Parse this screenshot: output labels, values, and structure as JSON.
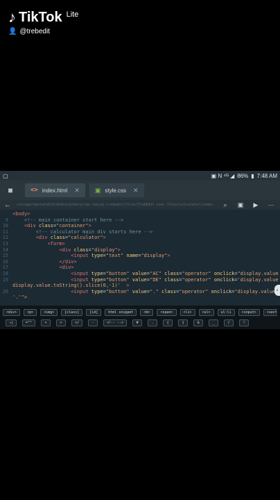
{
  "watermark": {
    "brand": "TikTok",
    "edition": "Lite",
    "username": "@trebedit"
  },
  "status_bar": {
    "indicators": "▣ N ⁴ᴳ ◢",
    "battery": "86%",
    "time": "7:48 AM"
  },
  "tabs": [
    {
      "icon": "<>",
      "label": "index.html",
      "close": "✕"
    },
    {
      "icon": "▣",
      "label": "style.css",
      "close": "✕"
    }
  ],
  "toolbar": {
    "path": "storage/emulated/0/Android/data/com.teejay.trebedit/files/TrebEdit user files/calculator/index.html"
  },
  "editor": {
    "lines": [
      {
        "n": "",
        "segs": [
          {
            "t": "<body>",
            "c": "tag"
          }
        ]
      },
      {
        "n": "9",
        "segs": [
          {
            "t": "    ",
            "c": "plain"
          },
          {
            "t": "<!-- main container start here -->",
            "c": "cmt"
          }
        ]
      },
      {
        "n": "10",
        "segs": [
          {
            "t": "    <div ",
            "c": "tag"
          },
          {
            "t": "class",
            "c": "attr"
          },
          {
            "t": "=",
            "c": "plain"
          },
          {
            "t": "\"container\"",
            "c": "str"
          },
          {
            "t": ">",
            "c": "tag"
          }
        ]
      },
      {
        "n": "11",
        "segs": [
          {
            "t": "        ",
            "c": "plain"
          },
          {
            "t": "<!-- calculator main div starts here -->",
            "c": "cmt"
          }
        ]
      },
      {
        "n": "12",
        "segs": [
          {
            "t": "        <div ",
            "c": "tag"
          },
          {
            "t": "class",
            "c": "attr"
          },
          {
            "t": "=",
            "c": "plain"
          },
          {
            "t": "\"calculator\"",
            "c": "str"
          },
          {
            "t": ">",
            "c": "tag"
          }
        ]
      },
      {
        "n": "13",
        "segs": [
          {
            "t": "            <form>",
            "c": "tag"
          }
        ]
      },
      {
        "n": "14",
        "segs": [
          {
            "t": "                <div ",
            "c": "tag"
          },
          {
            "t": "class",
            "c": "attr"
          },
          {
            "t": "=",
            "c": "plain"
          },
          {
            "t": "\"display\"",
            "c": "str"
          },
          {
            "t": ">",
            "c": "tag"
          }
        ]
      },
      {
        "n": "15",
        "segs": [
          {
            "t": "                    <input ",
            "c": "tag"
          },
          {
            "t": "type",
            "c": "attr"
          },
          {
            "t": "=",
            "c": "plain"
          },
          {
            "t": "\"text\"",
            "c": "str"
          },
          {
            "t": " name",
            "c": "attr"
          },
          {
            "t": "=",
            "c": "plain"
          },
          {
            "t": "\"display\"",
            "c": "str"
          },
          {
            "t": ">",
            "c": "tag"
          }
        ]
      },
      {
        "n": "16",
        "segs": [
          {
            "t": "                </div>",
            "c": "tag"
          }
        ]
      },
      {
        "n": "17",
        "segs": [
          {
            "t": "                <div>",
            "c": "tag"
          }
        ]
      },
      {
        "n": "18",
        "segs": [
          {
            "t": "                    <input ",
            "c": "tag"
          },
          {
            "t": "type",
            "c": "attr"
          },
          {
            "t": "=",
            "c": "plain"
          },
          {
            "t": "\"button\"",
            "c": "str"
          },
          {
            "t": " value",
            "c": "attr"
          },
          {
            "t": "=",
            "c": "plain"
          },
          {
            "t": "\"AC\"",
            "c": "str"
          },
          {
            "t": " class",
            "c": "attr"
          },
          {
            "t": "=",
            "c": "plain"
          },
          {
            "t": "\"operator\"",
            "c": "str"
          },
          {
            "t": " onclick",
            "c": "attr"
          },
          {
            "t": "=",
            "c": "plain"
          },
          {
            "t": "\"display.value = ''\">",
            "c": "str"
          }
        ]
      },
      {
        "n": "19",
        "segs": [
          {
            "t": "                    <input ",
            "c": "tag"
          },
          {
            "t": "type",
            "c": "attr"
          },
          {
            "t": "=",
            "c": "plain"
          },
          {
            "t": "\"button\"",
            "c": "str"
          },
          {
            "t": " value",
            "c": "attr"
          },
          {
            "t": "=",
            "c": "plain"
          },
          {
            "t": "\"DE\"",
            "c": "str"
          },
          {
            "t": " class",
            "c": "attr"
          },
          {
            "t": "=",
            "c": "plain"
          },
          {
            "t": "\"operator\"",
            "c": "str"
          },
          {
            "t": " onclick",
            "c": "attr"
          },
          {
            "t": "=",
            "c": "plain"
          },
          {
            "t": "'display.value =",
            "c": "str"
          }
        ]
      },
      {
        "n": "",
        "segs": [
          {
            "t": "display.value.toString().slice(0,-1)'",
            "c": "str"
          },
          {
            "t": "  >",
            "c": "tag"
          }
        ]
      },
      {
        "n": "20",
        "segs": [
          {
            "t": "                    <input ",
            "c": "tag"
          },
          {
            "t": "type",
            "c": "attr"
          },
          {
            "t": "=",
            "c": "plain"
          },
          {
            "t": "\"button\"",
            "c": "str"
          },
          {
            "t": " value",
            "c": "attr"
          },
          {
            "t": "=",
            "c": "plain"
          },
          {
            "t": "\".\"",
            "c": "str"
          },
          {
            "t": " class",
            "c": "attr"
          },
          {
            "t": "=",
            "c": "plain"
          },
          {
            "t": "\"operator\"",
            "c": "str"
          },
          {
            "t": " onclick",
            "c": "attr"
          },
          {
            "t": "=",
            "c": "plain"
          },
          {
            "t": "\"display.value +=",
            "c": "str"
          }
        ]
      },
      {
        "n": "",
        "segs": [
          {
            "t": "'.'\">",
            "c": "str"
          }
        ]
      }
    ]
  },
  "snippet_keys": [
    "<div>",
    "<p>",
    "<img>",
    "[class]",
    "[id]",
    "html snippet",
    "<b>",
    "<span>",
    "<li>",
    "<ul>",
    "ul:li",
    "<input>",
    "<section>"
  ],
  "symbol_keys": [
    "→|",
    "=\"\"",
    "<",
    ">",
    "</",
    "-",
    "<!-- -->",
    "#",
    ".",
    "{",
    "}",
    "&",
    "_",
    "/",
    "!"
  ]
}
